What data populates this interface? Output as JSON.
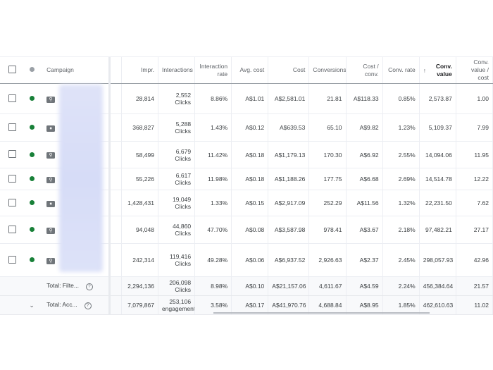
{
  "headers": {
    "campaign": "Campaign",
    "impr": "Impr.",
    "interactions": "Interactions",
    "interaction_rate": "Interaction rate",
    "avg_cost": "Avg. cost",
    "cost": "Cost",
    "conversions": "Conversions",
    "cost_conv": "Cost / conv.",
    "conv_rate": "Conv. rate",
    "conv_value": "Conv. value",
    "conv_value_cost": "Conv. value / cost",
    "sort_icon": "↑"
  },
  "colors": {
    "status_enabled": "#188038"
  },
  "rows": [
    {
      "type_icon": "search-icon",
      "impr": "28,814",
      "interactions": "2,552",
      "unit": "Clicks",
      "interaction_rate": "8.86%",
      "avg_cost": "A$1.01",
      "cost": "A$2,581.01",
      "conversions": "21.81",
      "cost_conv": "A$118.33",
      "conv_rate": "0.85%",
      "conv_value": "2,573.87",
      "conv_value_cost": "1.00"
    },
    {
      "type_icon": "tag-icon",
      "impr": "368,827",
      "interactions": "5,288",
      "unit": "Clicks",
      "interaction_rate": "1.43%",
      "avg_cost": "A$0.12",
      "cost": "A$639.53",
      "conversions": "65.10",
      "cost_conv": "A$9.82",
      "conv_rate": "1.23%",
      "conv_value": "5,109.37",
      "conv_value_cost": "7.99"
    },
    {
      "type_icon": "search-icon",
      "impr": "58,499",
      "interactions": "6,679",
      "unit": "Clicks",
      "interaction_rate": "11.42%",
      "avg_cost": "A$0.18",
      "cost": "A$1,179.13",
      "conversions": "170.30",
      "cost_conv": "A$6.92",
      "conv_rate": "2.55%",
      "conv_value": "14,094.06",
      "conv_value_cost": "11.95"
    },
    {
      "type_icon": "search-icon",
      "impr": "55,226",
      "interactions": "6,617",
      "unit": "Clicks",
      "interaction_rate": "11.98%",
      "avg_cost": "A$0.18",
      "cost": "A$1,188.26",
      "conversions": "177.75",
      "cost_conv": "A$6.68",
      "conv_rate": "2.69%",
      "conv_value": "14,514.78",
      "conv_value_cost": "12.22"
    },
    {
      "type_icon": "tag-icon",
      "impr": "1,428,431",
      "interactions": "19,049",
      "unit": "Clicks",
      "interaction_rate": "1.33%",
      "avg_cost": "A$0.15",
      "cost": "A$2,917.09",
      "conversions": "252.29",
      "cost_conv": "A$11.56",
      "conv_rate": "1.32%",
      "conv_value": "22,231.50",
      "conv_value_cost": "7.62"
    },
    {
      "type_icon": "search-icon",
      "impr": "94,048",
      "interactions": "44,860",
      "unit": "Clicks",
      "interaction_rate": "47.70%",
      "avg_cost": "A$0.08",
      "cost": "A$3,587.98",
      "conversions": "978.41",
      "cost_conv": "A$3.67",
      "conv_rate": "2.18%",
      "conv_value": "97,482.21",
      "conv_value_cost": "27.17"
    },
    {
      "type_icon": "search-icon",
      "impr": "242,314",
      "interactions": "119,416",
      "unit": "Clicks",
      "interaction_rate": "49.28%",
      "avg_cost": "A$0.06",
      "cost": "A$6,937.52",
      "conversions": "2,926.63",
      "cost_conv": "A$2.37",
      "conv_rate": "2.45%",
      "conv_value": "298,057.93",
      "conv_value_cost": "42.96"
    }
  ],
  "totals": [
    {
      "label": "Total: Filte...",
      "impr": "2,294,136",
      "interactions": "206,098",
      "unit": "Clicks",
      "interaction_rate": "8.98%",
      "avg_cost": "A$0.10",
      "cost": "A$21,157.06",
      "conversions": "4,611.67",
      "cost_conv": "A$4.59",
      "conv_rate": "2.24%",
      "conv_value": "456,384.64",
      "conv_value_cost": "21.57"
    },
    {
      "label": "Total: Acc...",
      "impr": "7,079,867",
      "interactions": "253,106",
      "unit": "engagements",
      "interaction_rate": "3.58%",
      "avg_cost": "A$0.17",
      "cost": "A$41,970.76",
      "conversions": "4,688.84",
      "cost_conv": "A$8.95",
      "conv_rate": "1.85%",
      "conv_value": "462,610.63",
      "conv_value_cost": "11.02"
    }
  ]
}
